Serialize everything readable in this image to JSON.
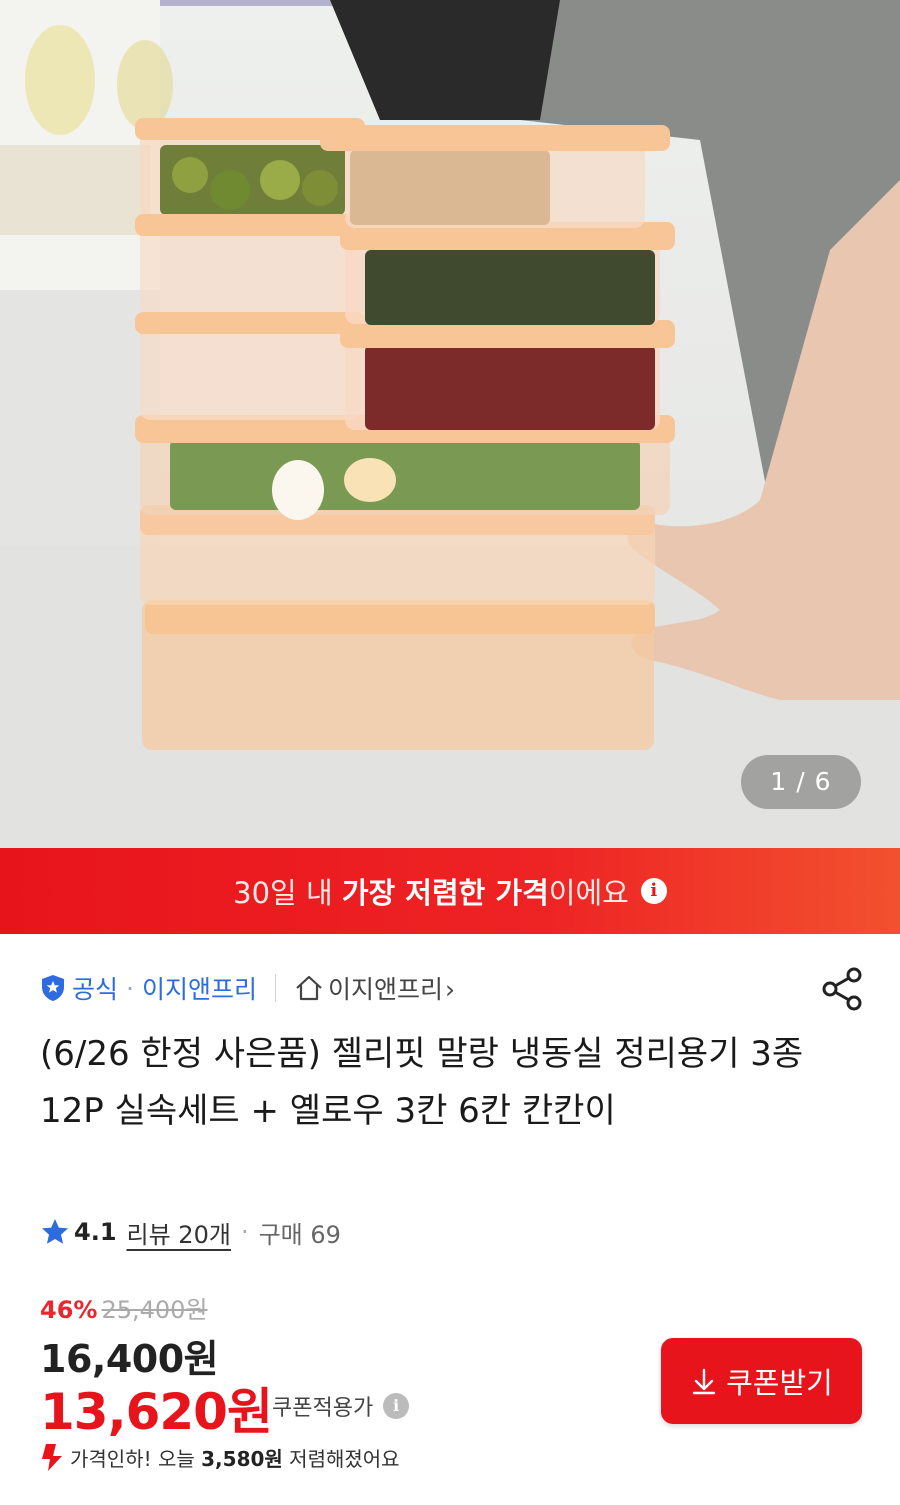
{
  "gallery": {
    "counter": "1 / 6"
  },
  "banner": {
    "part1": "30일 내 ",
    "bold": "가장 저렴한 가격",
    "part2": "이에요",
    "info_icon": "i"
  },
  "seller": {
    "official_label": "공식",
    "dot": "·",
    "store_name": "이지앤프리",
    "shop_link": "이지앤프리",
    "shop_chevron": "›"
  },
  "product": {
    "title": "(6/26 한정 사은품) 젤리핏 말랑 냉동실 정리용기 3종 12P 실속세트 + 옐로우 3칸 6칸 칸칸이"
  },
  "rating": {
    "score": "4.1",
    "review_label": "리뷰 20개",
    "dot": "·",
    "purchase_label": "구매 69"
  },
  "price": {
    "discount_percent": "46%",
    "original_price": "25,400원",
    "sale_price": "16,400원",
    "coupon_price": "13,620원",
    "coupon_applied_label": "쿠폰적용가",
    "info_icon": "i",
    "drop_prefix": "가격인하! 오늘 ",
    "drop_amount": "3,580원",
    "drop_suffix": " 저렴해졌어요"
  },
  "actions": {
    "coupon_button_label": "쿠폰받기"
  },
  "colors": {
    "accent_red": "#e8141c",
    "link_blue": "#2d6bdf"
  }
}
